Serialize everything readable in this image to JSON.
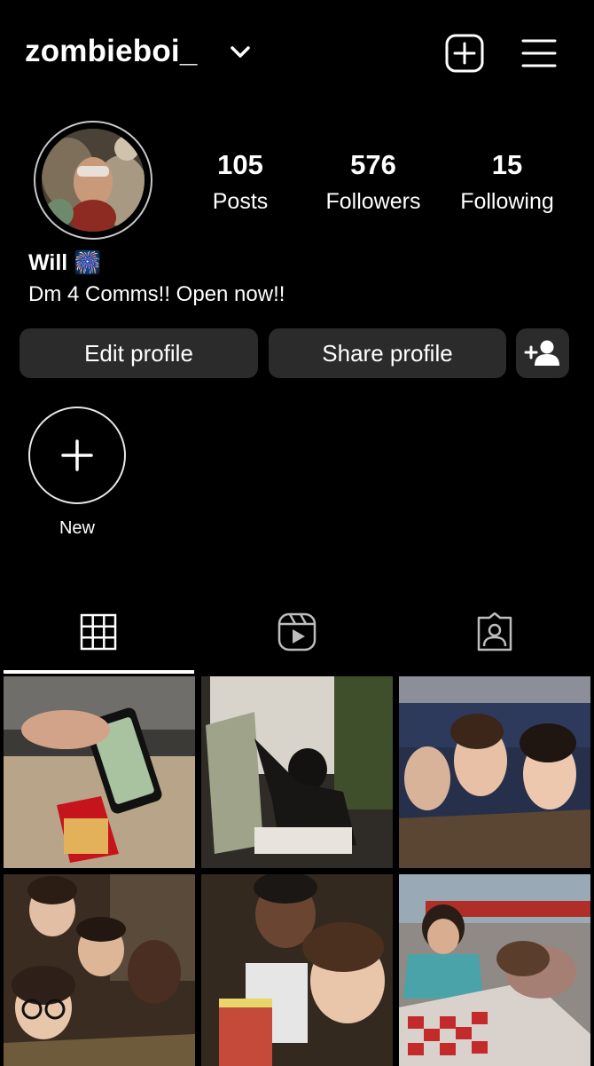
{
  "header": {
    "username": "zombieboi_"
  },
  "stats": [
    {
      "value": "105",
      "label": "Posts"
    },
    {
      "value": "576",
      "label": "Followers"
    },
    {
      "value": "15",
      "label": "Following"
    }
  ],
  "profile": {
    "name": "Will 🎆",
    "bio": "Dm 4 Comms!! Open now!!"
  },
  "buttons": {
    "edit": "Edit profile",
    "share": "Share profile"
  },
  "highlights": {
    "new_label": "New"
  },
  "tabs": [
    {
      "icon": "grid-icon",
      "active": true
    },
    {
      "icon": "reels-icon",
      "active": false
    },
    {
      "icon": "tagged-icon",
      "active": false
    }
  ],
  "posts": [
    {
      "thumb": "photo-phone-and-fries"
    },
    {
      "thumb": "photo-painting-silhouette"
    },
    {
      "thumb": "photo-group-selfie-crowd"
    },
    {
      "thumb": "photo-group-friends"
    },
    {
      "thumb": "photo-selfie-two"
    },
    {
      "thumb": "photo-diner-table"
    }
  ]
}
